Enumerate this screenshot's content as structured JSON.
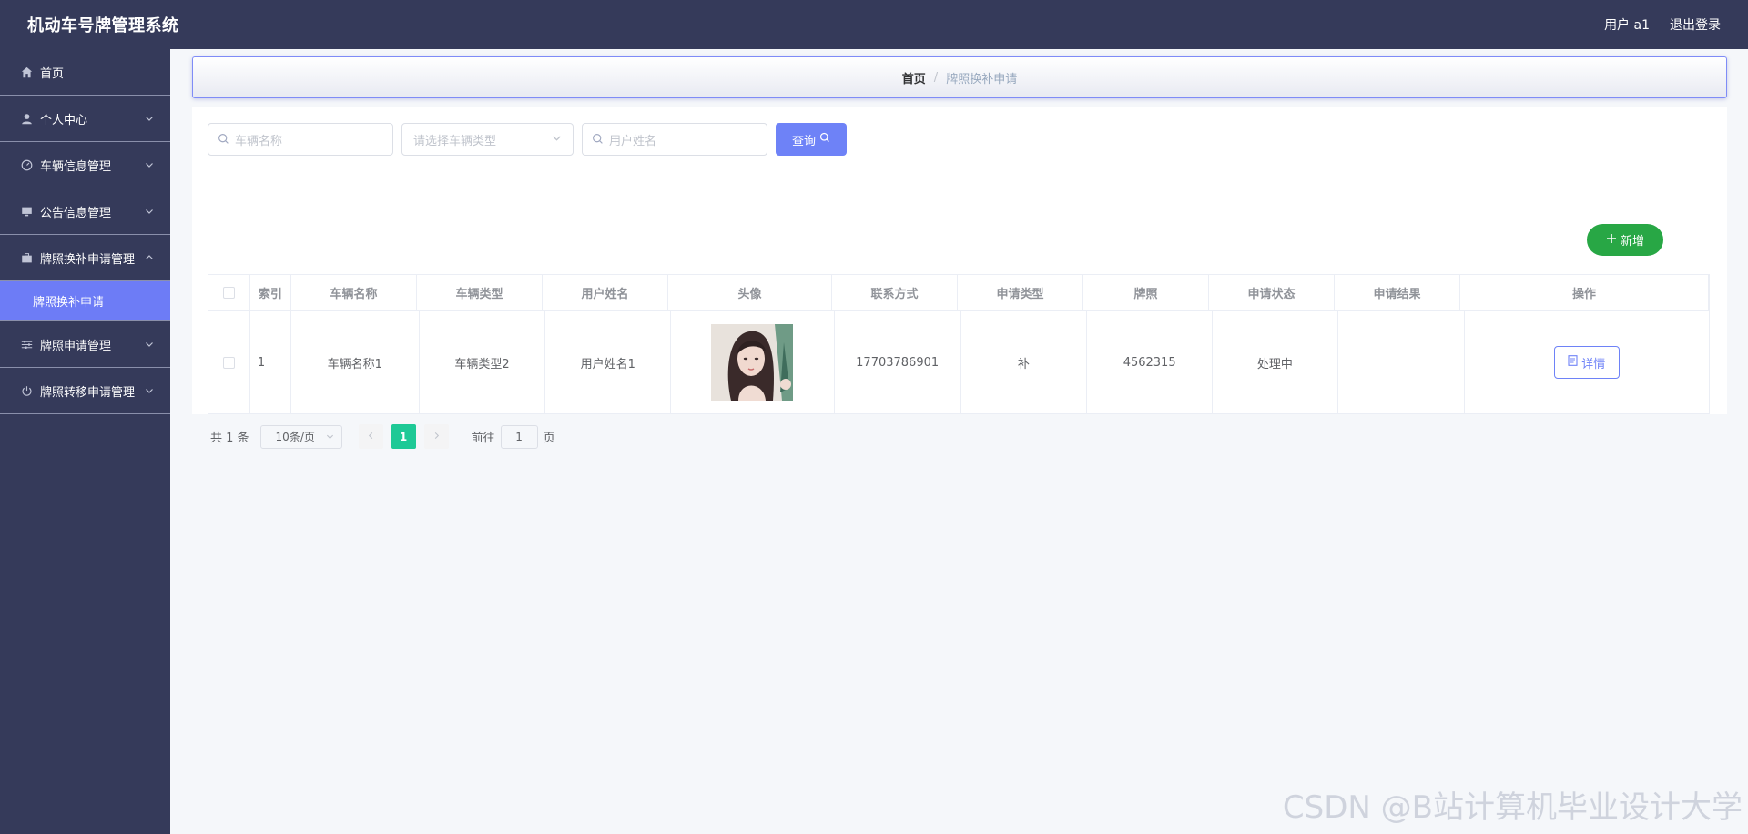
{
  "header": {
    "title": "机动车号牌管理系统",
    "user_label": "用户 a1",
    "logout_label": "退出登录"
  },
  "sidebar": {
    "items": [
      {
        "label": "首页",
        "icon": "home-icon"
      },
      {
        "label": "个人中心",
        "icon": "user-icon"
      },
      {
        "label": "车辆信息管理",
        "icon": "dashboard-icon"
      },
      {
        "label": "公告信息管理",
        "icon": "monitor-icon"
      },
      {
        "label": "牌照换补申请管理",
        "icon": "briefcase-icon"
      },
      {
        "label": "牌照申请管理",
        "icon": "sliders-icon"
      },
      {
        "label": "牌照转移申请管理",
        "icon": "power-icon"
      }
    ],
    "active_sub": "牌照换补申请"
  },
  "breadcrumb": {
    "home": "首页",
    "separator": "/",
    "current": "牌照换补申请"
  },
  "search": {
    "vehicle_name_placeholder": "车辆名称",
    "vehicle_type_placeholder": "请选择车辆类型",
    "user_name_placeholder": "用户姓名",
    "query_label": "查询"
  },
  "add_label": "新增",
  "table": {
    "headers": [
      "索引",
      "车辆名称",
      "车辆类型",
      "用户姓名",
      "头像",
      "联系方式",
      "申请类型",
      "牌照",
      "申请状态",
      "申请结果",
      "操作"
    ],
    "rows": [
      {
        "index": "1",
        "vehicle_name": "车辆名称1",
        "vehicle_type": "车辆类型2",
        "user_name": "用户姓名1",
        "avatar": "avatar-image",
        "contact": "17703786901",
        "apply_type": "补",
        "plate": "4562315",
        "status": "处理中",
        "result": "",
        "action_label": "详情"
      }
    ]
  },
  "pagination": {
    "total": "共 1 条",
    "page_size": "10条/页",
    "current_page": "1",
    "goto_prefix": "前往",
    "goto_value": "1",
    "goto_suffix": "页"
  },
  "watermark": "CSDN @B站计算机毕业设计大学",
  "colors": {
    "header_bg": "#353a5a",
    "accent": "#6e82f7",
    "add_button": "#28a745",
    "page_active": "#1ec996"
  }
}
